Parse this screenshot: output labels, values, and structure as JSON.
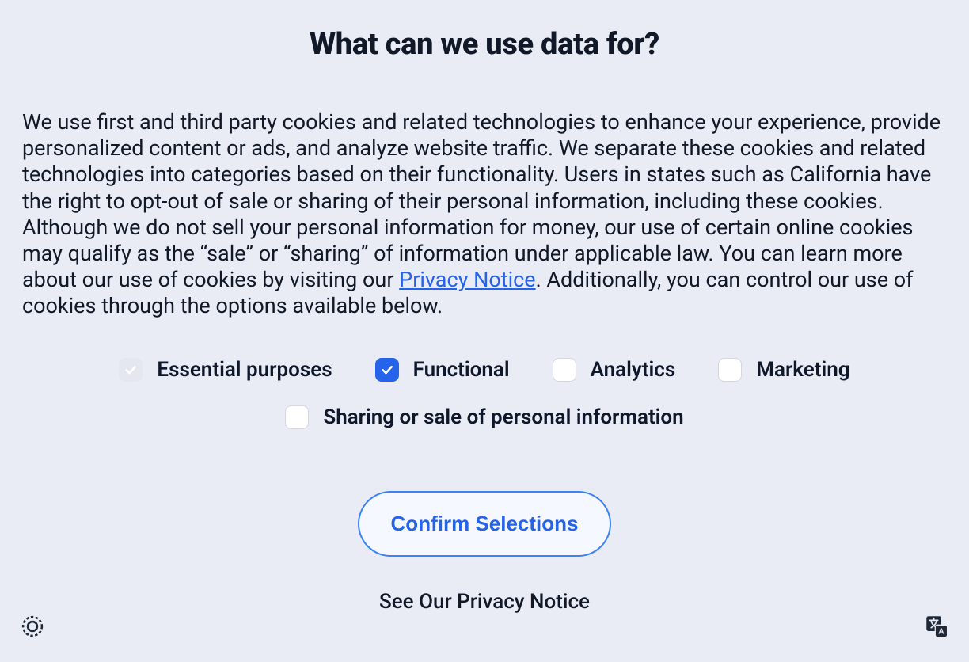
{
  "title": "What can we use data for?",
  "description": {
    "part1": "We use first and third party cookies and related technologies to enhance your experience, provide personalized content or ads, and analyze website traffic. We separate these cookies and related technologies into categories based on their functionality. Users in states such as California have the right to opt-out of sale or sharing of their personal information, including these cookies. Although we do not sell your personal information for money, our use of certain online cookies may qualify as the “sale” or “sharing” of information under applicable law. You can learn more about our use of cookies by visiting our ",
    "link_text": "Privacy Notice",
    "part2": ". Additionally, you can control our use of cookies through the options available below."
  },
  "options": {
    "essential": {
      "label": "Essential purposes",
      "checked": true,
      "disabled": true
    },
    "functional": {
      "label": "Functional",
      "checked": true,
      "disabled": false
    },
    "analytics": {
      "label": "Analytics",
      "checked": false,
      "disabled": false
    },
    "marketing": {
      "label": "Marketing",
      "checked": false,
      "disabled": false
    },
    "sharing": {
      "label": "Sharing or sale of personal information",
      "checked": false,
      "disabled": false
    }
  },
  "confirm_button": "Confirm Selections",
  "privacy_notice_link": "See Our Privacy Notice"
}
